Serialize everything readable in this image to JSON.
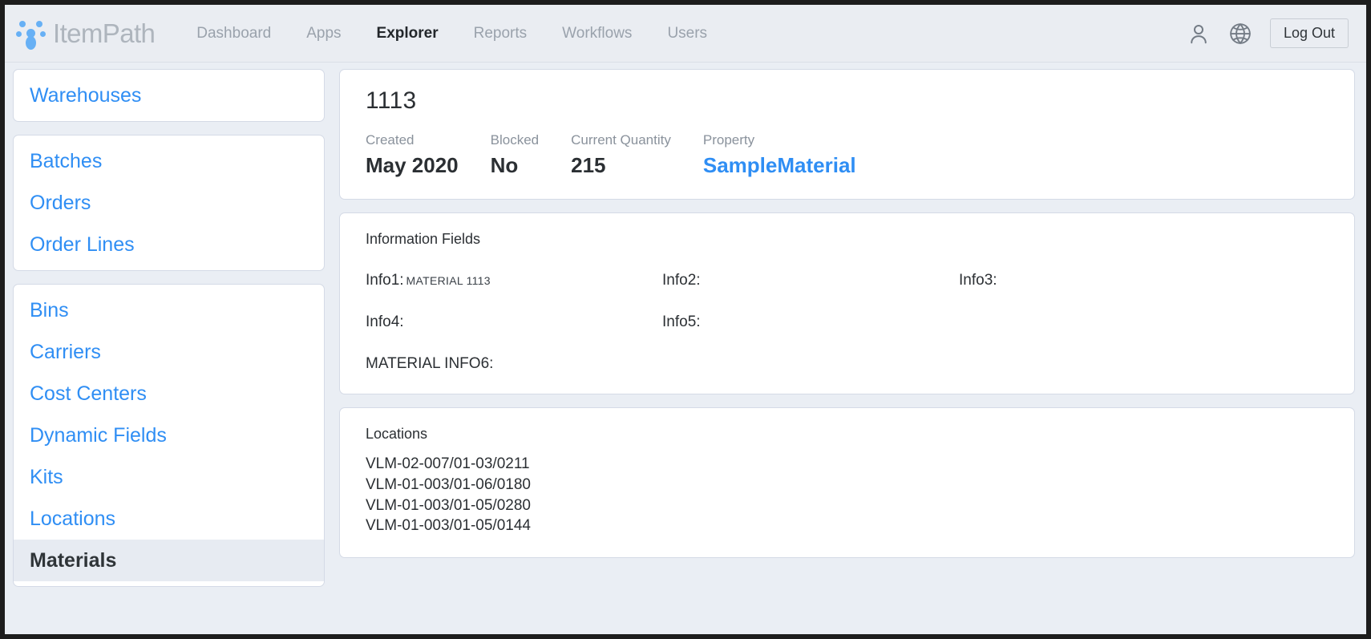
{
  "header": {
    "brand": "ItemPath",
    "nav": [
      {
        "label": "Dashboard",
        "active": false
      },
      {
        "label": "Apps",
        "active": false
      },
      {
        "label": "Explorer",
        "active": true
      },
      {
        "label": "Reports",
        "active": false
      },
      {
        "label": "Workflows",
        "active": false
      },
      {
        "label": "Users",
        "active": false
      }
    ],
    "icons": [
      "user-icon",
      "globe-icon"
    ],
    "logout_label": "Log Out",
    "accent_color": "#2f8ef4",
    "brand_color": "#aeb5bd"
  },
  "sidebar": {
    "groups": [
      {
        "items": [
          {
            "label": "Warehouses",
            "active": false
          }
        ]
      },
      {
        "items": [
          {
            "label": "Batches",
            "active": false
          },
          {
            "label": "Orders",
            "active": false
          },
          {
            "label": "Order Lines",
            "active": false
          }
        ]
      },
      {
        "items": [
          {
            "label": "Bins",
            "active": false
          },
          {
            "label": "Carriers",
            "active": false
          },
          {
            "label": "Cost Centers",
            "active": false
          },
          {
            "label": "Dynamic Fields",
            "active": false
          },
          {
            "label": "Kits",
            "active": false
          },
          {
            "label": "Locations",
            "active": false
          },
          {
            "label": "Materials",
            "active": true
          }
        ]
      }
    ]
  },
  "main": {
    "summary": {
      "title": "1113",
      "stats": [
        {
          "label": "Created",
          "value": "May 2020",
          "link": false
        },
        {
          "label": "Blocked",
          "value": "No",
          "link": false
        },
        {
          "label": "Current Quantity",
          "value": "215",
          "link": false
        },
        {
          "label": "Property",
          "value": "SampleMaterial",
          "link": true
        }
      ]
    },
    "information_fields": {
      "heading": "Information Fields",
      "fields": [
        {
          "label": "Info1:",
          "value": "MATERIAL 1113"
        },
        {
          "label": "Info2:",
          "value": ""
        },
        {
          "label": "Info3:",
          "value": ""
        },
        {
          "label": "Info4:",
          "value": ""
        },
        {
          "label": "Info5:",
          "value": ""
        }
      ],
      "full_row": {
        "label": "MATERIAL INFO6:",
        "value": ""
      }
    },
    "locations": {
      "heading": "Locations",
      "rows": [
        "VLM-02-007/01-03/0211",
        "VLM-01-003/01-06/0180",
        "VLM-01-003/01-05/0280",
        "VLM-01-003/01-05/0144"
      ]
    }
  }
}
